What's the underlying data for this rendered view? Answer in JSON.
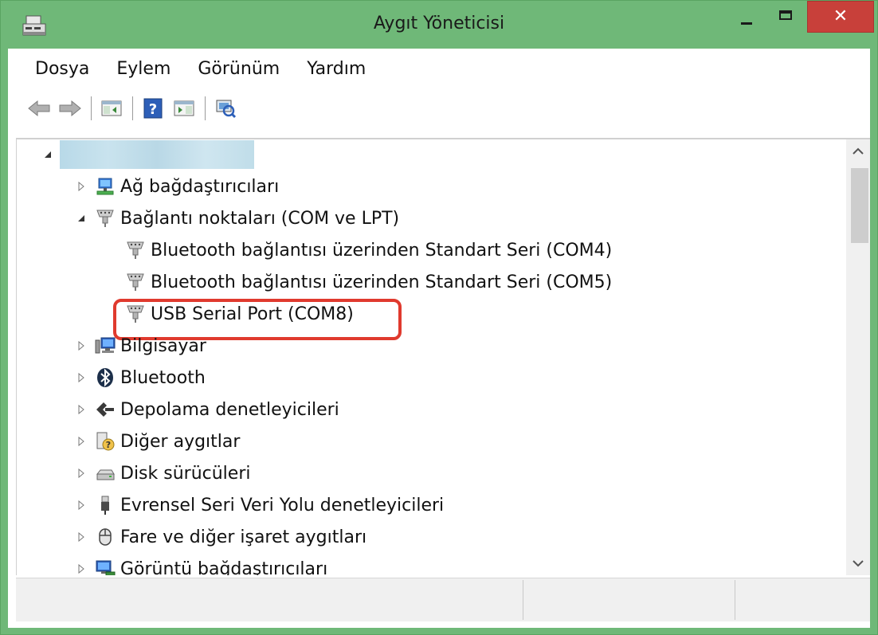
{
  "window": {
    "title": "Aygıt Yöneticisi"
  },
  "menu": [
    "Dosya",
    "Eylem",
    "Görünüm",
    "Yardım"
  ],
  "toolbar": {
    "icons": [
      "back-arrow-icon",
      "forward-arrow-icon",
      "show-hide-console-tree-icon",
      "help-icon",
      "show-hide-action-pane-icon",
      "scan-hardware-changes-icon"
    ]
  },
  "tree": {
    "root": {
      "label": "",
      "expanded": true
    },
    "items": [
      {
        "label": "Ağ bağdaştırıcıları",
        "expanded": false,
        "icon": "network-adapter-icon"
      },
      {
        "label": "Bağlantı noktaları (COM ve LPT)",
        "expanded": true,
        "icon": "port-connector-icon",
        "children": [
          {
            "label": "Bluetooth bağlantısı üzerinden Standart Seri (COM4)",
            "icon": "port-connector-icon"
          },
          {
            "label": "Bluetooth bağlantısı üzerinden Standart Seri (COM5)",
            "icon": "port-connector-icon"
          },
          {
            "label": "USB Serial Port (COM8)",
            "icon": "port-connector-icon",
            "highlighted": true
          }
        ]
      },
      {
        "label": "Bilgisayar",
        "expanded": false,
        "icon": "computer-icon"
      },
      {
        "label": "Bluetooth",
        "expanded": false,
        "icon": "bluetooth-icon"
      },
      {
        "label": "Depolama denetleyicileri",
        "expanded": false,
        "icon": "storage-controller-icon"
      },
      {
        "label": "Diğer aygıtlar",
        "expanded": false,
        "icon": "unknown-device-icon"
      },
      {
        "label": "Disk sürücüleri",
        "expanded": false,
        "icon": "disk-drive-icon"
      },
      {
        "label": "Evrensel Seri Veri Yolu denetleyicileri",
        "expanded": false,
        "icon": "usb-icon"
      },
      {
        "label": "Fare ve diğer işaret aygıtları",
        "expanded": false,
        "icon": "mouse-icon"
      },
      {
        "label": "Görüntü bağdaştırıcıları",
        "expanded": false,
        "icon": "display-adapter-icon"
      }
    ]
  },
  "colors": {
    "frame": "#6fb878",
    "close": "#c8403a",
    "highlight": "#e03a2e"
  }
}
